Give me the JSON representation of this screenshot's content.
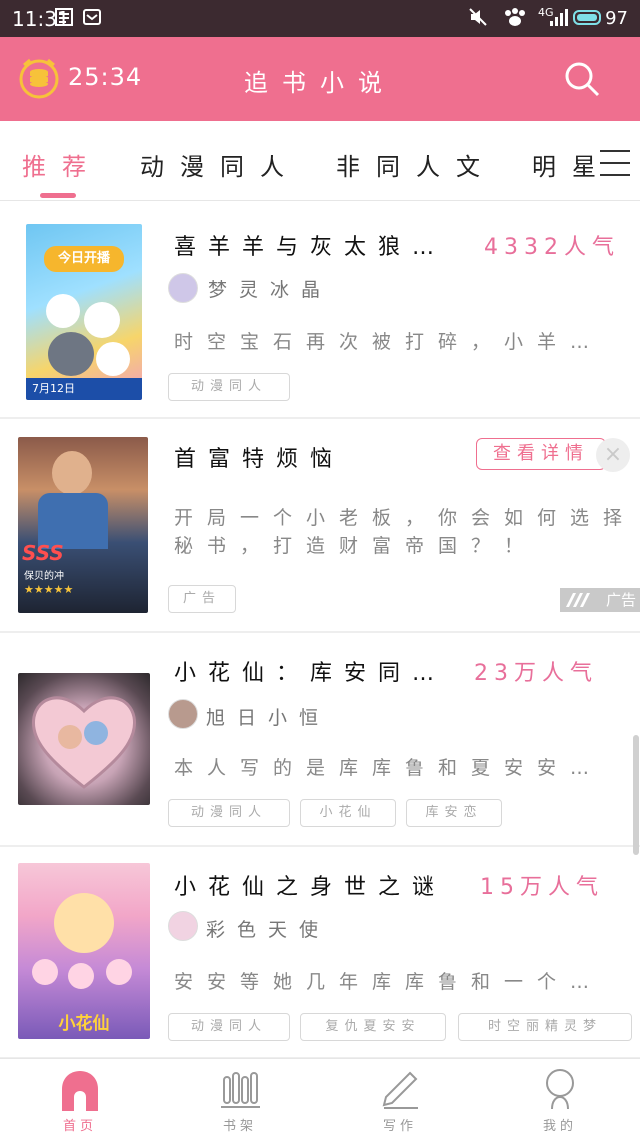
{
  "status_bar": {
    "time": "11:31",
    "battery": "97",
    "network_label": "4G"
  },
  "header": {
    "timer": "25:34",
    "title": "追书小说",
    "icons": [
      "coin-timer-icon",
      "search-icon"
    ]
  },
  "tabs": [
    {
      "label": "推荐",
      "active": true
    },
    {
      "label": "动漫同人",
      "active": false
    },
    {
      "label": "非同人文",
      "active": false
    },
    {
      "label": "明星",
      "active": false
    }
  ],
  "books": [
    {
      "title": "喜羊羊与灰太狼…",
      "popularity": "4332人气",
      "author": "梦灵冰晶",
      "description": "时空宝石再次被打碎，小羊…",
      "tags": [
        "动漫同人"
      ],
      "cover_text": [
        "今日开播",
        "7月12日"
      ]
    },
    {
      "title": "小花仙：库安同…",
      "popularity": "23万人气",
      "author": "旭日小恒",
      "description": "本人写的是库库鲁和夏安安…",
      "tags": [
        "动漫同人",
        "小花仙",
        "库安恋"
      ]
    },
    {
      "title": "小花仙之身世之谜",
      "popularity": "15万人气",
      "author": "彩色天使",
      "description": "安安等她几年库库鲁和一个…",
      "tags": [
        "动漫同人",
        "复仇夏安安",
        "时空丽精灵梦"
      ],
      "cover_text": [
        "小花仙"
      ]
    }
  ],
  "ad": {
    "title": "首富特烦恼",
    "button": "查看详情",
    "description_line1": "开局一个小老板，你会如何选择",
    "description_line2": "秘书，打造财富帝国？！",
    "tag": "广告",
    "label": "广告",
    "cover_text": [
      "SSS",
      "保贝的冲"
    ]
  },
  "bottom_nav": [
    {
      "label": "首页",
      "icon": "home-icon",
      "active": true
    },
    {
      "label": "书架",
      "icon": "bookshelf-icon",
      "active": false
    },
    {
      "label": "写作",
      "icon": "pencil-icon",
      "active": false
    },
    {
      "label": "我的",
      "icon": "profile-icon",
      "active": false
    }
  ],
  "colors": {
    "accent": "#ef6f8f",
    "status_bar": "#3c2a30",
    "popularity": "#e86f9a"
  }
}
